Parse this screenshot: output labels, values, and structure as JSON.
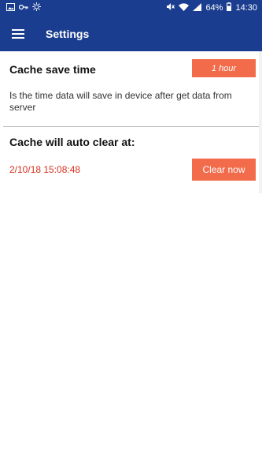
{
  "status_bar": {
    "battery": "64%",
    "time": "14:30",
    "icons_left": [
      "image-icon",
      "key-icon",
      "brightness-icon"
    ],
    "icons_right": [
      "mute-icon",
      "wifi-icon",
      "signal-icon",
      "battery-icon"
    ]
  },
  "app_bar": {
    "title": "Settings",
    "menu_icon": "hamburger-menu-icon"
  },
  "cache_save": {
    "title": "Cache save time",
    "button_label": "1 hour",
    "description": "Is the time data will save in device after get data from server"
  },
  "cache_clear": {
    "title": "Cache will auto clear at:",
    "timestamp": "2/10/18 15:08:48",
    "button_label": "Clear now"
  },
  "colors": {
    "primary": "#1a3d8f",
    "accent": "#f26b4b",
    "timestamp": "#d9311d"
  }
}
